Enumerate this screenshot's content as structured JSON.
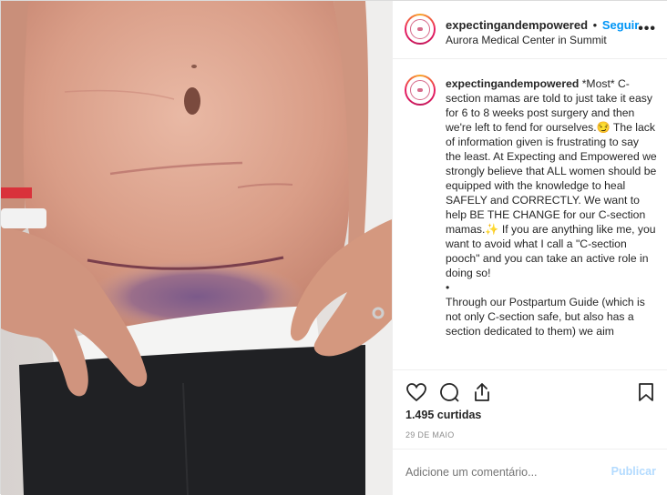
{
  "post": {
    "username": "expectingandempowered",
    "separator": "•",
    "follow_label": "Seguir",
    "location": "Aurora Medical Center in Summit",
    "more_label": "•••"
  },
  "caption": {
    "username": "expectingandempowered",
    "text": "*Most* C-section mamas are told to just take it easy for 6 to 8 weeks post surgery and then we're left to fend for ourselves.😏 The lack of information given is frustrating to say the least. At Expecting and Empowered we strongly believe that ALL women should be equipped with the knowledge to heal SAFELY and CORRECTLY. We want to help BE THE CHANGE for our C-section mamas.✨ If you are anything like me, you want to avoid what I call a \"C-section pooch\" and you can take an active role in doing so!\n•\nThrough our Postpartum Guide (which is not only C-section safe, but also has a section dedicated to them) we aim"
  },
  "actions": {
    "like_icon": "heart-icon",
    "comment_icon": "speech-bubble-icon",
    "share_icon": "paper-plane-icon",
    "save_icon": "bookmark-icon"
  },
  "likes": "1.495 curtidas",
  "date": "29 DE MAIO",
  "comment": {
    "placeholder": "Adicione um comentário...",
    "publish_label": "Publicar"
  },
  "colors": {
    "link_blue": "#0095f6",
    "publish_disabled": "#b3dbff",
    "muted": "#8e8e8e",
    "text": "#262626"
  }
}
